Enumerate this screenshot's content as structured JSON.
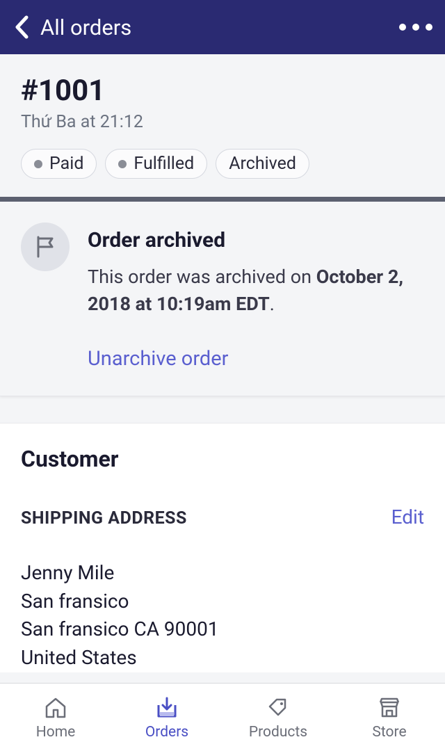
{
  "header": {
    "title": "All orders"
  },
  "order": {
    "number": "#1001",
    "date": "Thứ Ba at 21:12",
    "badges": {
      "paid": "Paid",
      "fulfilled": "Fulfilled",
      "archived": "Archived"
    }
  },
  "archived": {
    "title": "Order archived",
    "text_prefix": "This order was archived on ",
    "text_date": "October 2, 2018 at 10:19am EDT",
    "text_suffix": ".",
    "unarchive": "Unarchive order"
  },
  "customer": {
    "title": "Customer",
    "shipping_label": "SHIPPING ADDRESS",
    "edit": "Edit",
    "address": {
      "name": "Jenny Mile",
      "line1": "San fransico",
      "line2": "San fransico CA 90001",
      "country": "United States"
    }
  },
  "tabs": {
    "home": "Home",
    "orders": "Orders",
    "products": "Products",
    "store": "Store"
  }
}
